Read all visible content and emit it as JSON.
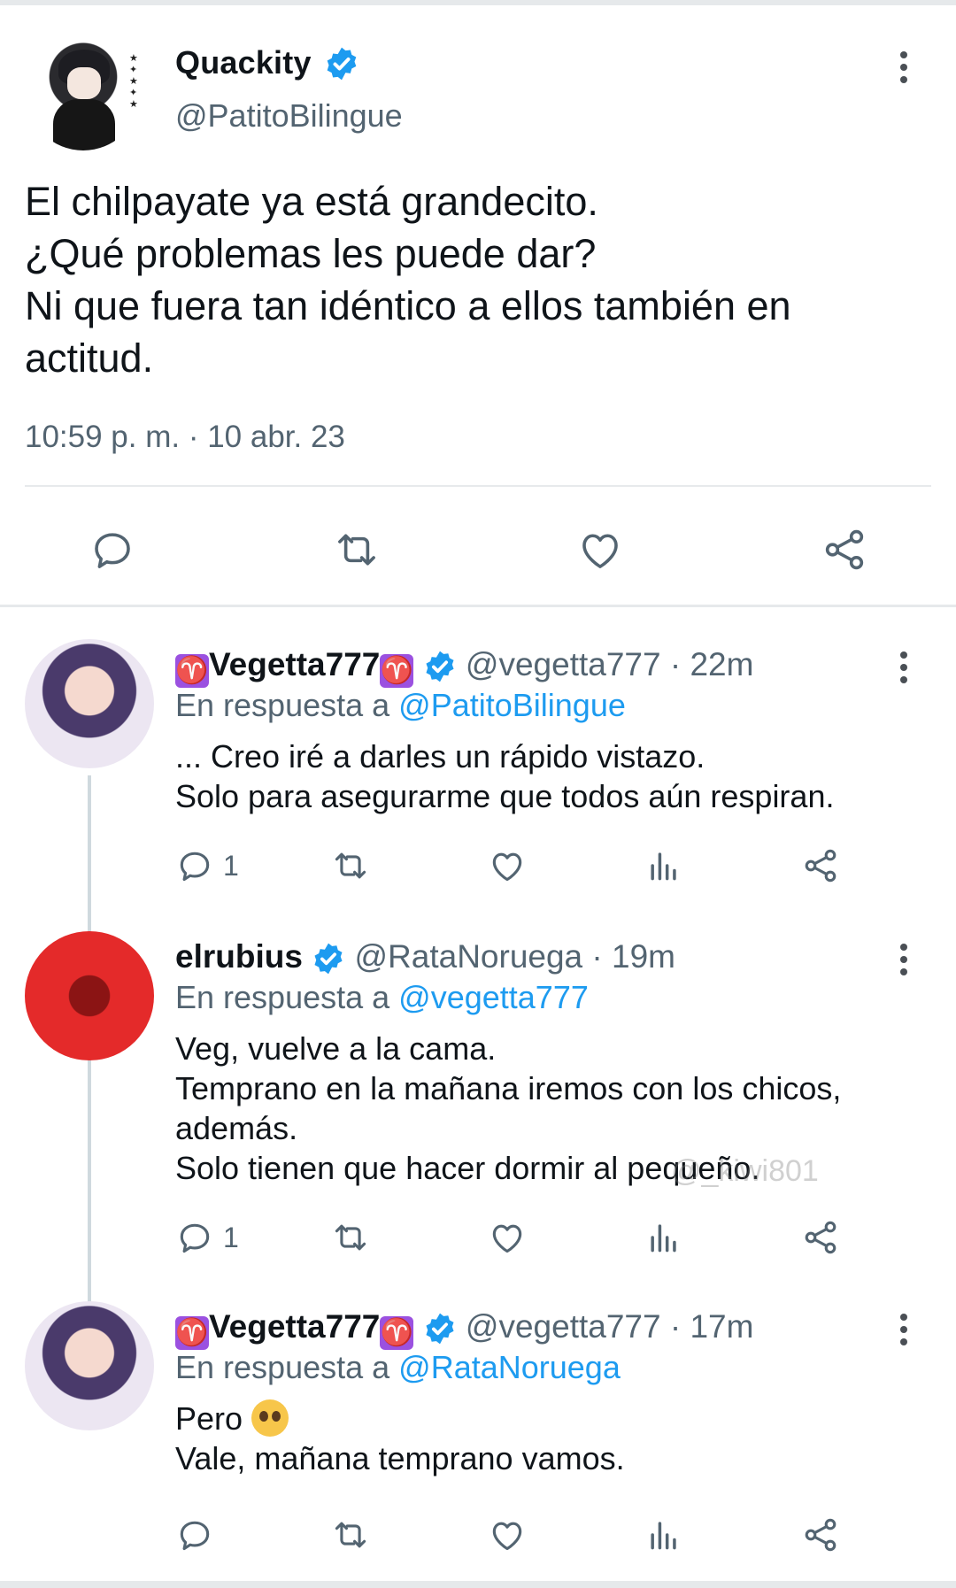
{
  "main_tweet": {
    "name": "Quackity",
    "handle": "@PatitoBilingue",
    "text_lines": [
      "El chilpayate ya está grandecito.",
      "¿Qué problemas les puede dar?",
      "Ni que fuera tan idéntico a ellos también en",
      "actitud."
    ],
    "timestamp": "10:59 p. m. · 10 abr. 23"
  },
  "replies": [
    {
      "name_prefix": "♈",
      "name": "Vegetta777",
      "name_suffix": "♈",
      "handle": "@vegetta777",
      "time": "· 22m",
      "reply_prefix": "En respuesta a ",
      "reply_to": "@PatitoBilingue",
      "text_lines": [
        "... Creo iré a darles un rápido vistazo.",
        "Solo para asegurarme que todos aún respiran."
      ],
      "reply_count": "1"
    },
    {
      "name": "elrubius",
      "handle": "@RataNoruega",
      "time": "· 19m",
      "reply_prefix": "En respuesta a ",
      "reply_to": "@vegetta777",
      "text_lines": [
        "Veg, vuelve a la cama.",
        "Temprano en la mañana iremos con los chicos,",
        "además.",
        "Solo tienen que hacer dormir al pequeño."
      ],
      "reply_count": "1"
    },
    {
      "name_prefix": "♈",
      "name": "Vegetta777",
      "name_suffix": "♈",
      "handle": "@vegetta777",
      "time": "· 17m",
      "reply_prefix": "En respuesta a ",
      "reply_to": "@RataNoruega",
      "text_lines": [
        "Pero",
        "Vale, mañana temprano vamos."
      ],
      "emoji": "pleading-face"
    }
  ],
  "watermark": "@_kiwi801",
  "colors": {
    "text": "#0f1419",
    "secondary": "#536471",
    "mention": "#1d9bf0",
    "verified": "#1d9bf0",
    "aries_badge": "#9b51e0"
  }
}
